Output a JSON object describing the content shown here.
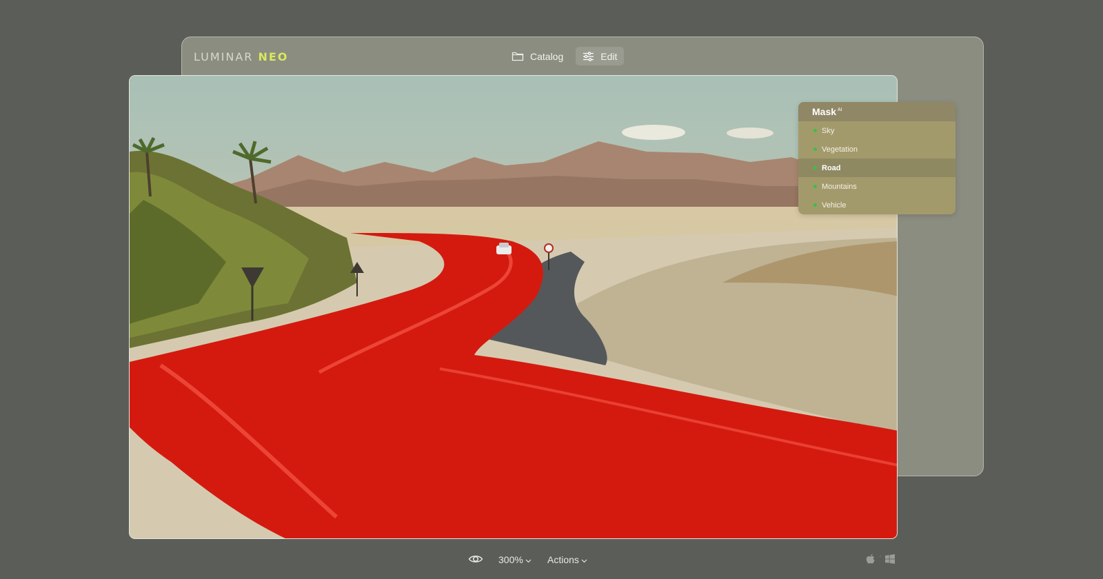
{
  "app": {
    "logo_part1": "LUMINAR ",
    "logo_part2": "NEO"
  },
  "nav": {
    "catalog_label": "Catalog",
    "edit_label": "Edit",
    "catalog_icon": "folder-icon",
    "edit_icon": "sliders-icon"
  },
  "mask_panel": {
    "title": "Mask",
    "title_sup": "AI",
    "items": [
      {
        "label": "Sky",
        "selected": false
      },
      {
        "label": "Vegetation",
        "selected": false
      },
      {
        "label": "Road",
        "selected": true
      },
      {
        "label": "Mountains",
        "selected": false
      },
      {
        "label": "Vehicle",
        "selected": false
      }
    ],
    "dot_color": "#35c24b"
  },
  "bottom_bar": {
    "zoom": "300%",
    "actions": "Actions",
    "icons": [
      "eye-icon",
      "chevron-down-icon",
      "apple-icon",
      "windows-icon"
    ]
  },
  "colors": {
    "background": "#5b5d58",
    "window": "#8b8d81",
    "accent": "#d9e85a",
    "mask_overlay": "#d41a0f"
  }
}
